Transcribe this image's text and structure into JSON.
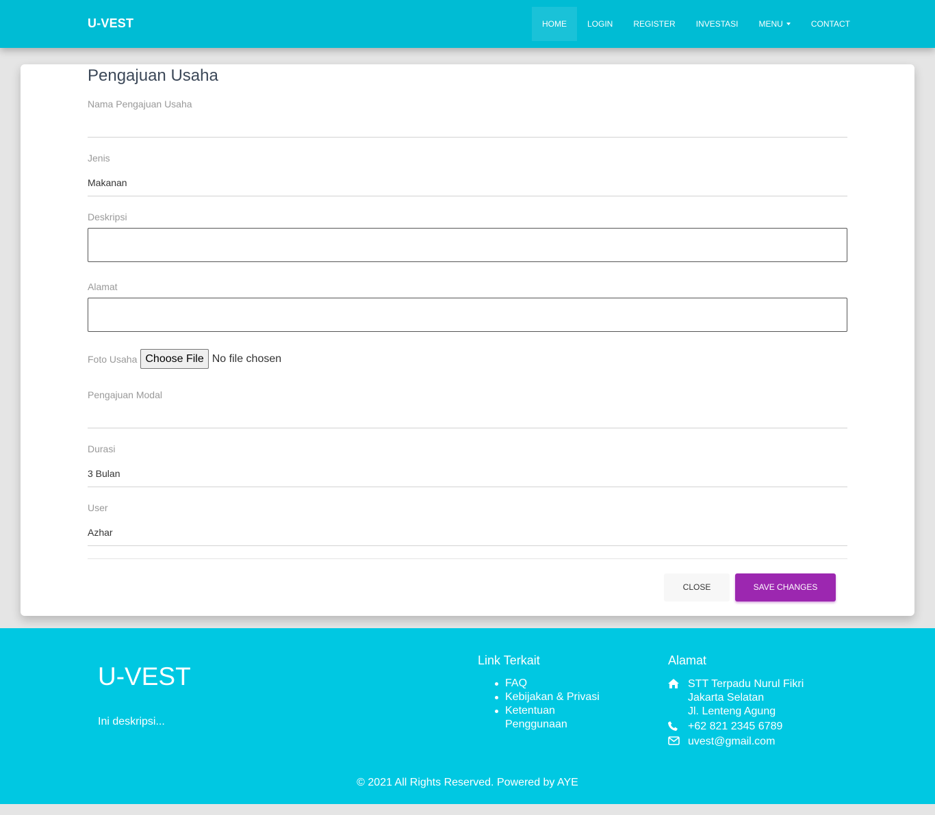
{
  "navbar": {
    "brand": "U-VEST",
    "items": [
      {
        "label": "Home"
      },
      {
        "label": "Login"
      },
      {
        "label": "Register"
      },
      {
        "label": "Investasi"
      },
      {
        "label": "Menu"
      },
      {
        "label": "Contact"
      }
    ]
  },
  "form": {
    "title": "Pengajuan Usaha",
    "nama_label": "Nama Pengajuan Usaha",
    "nama_value": "",
    "jenis_label": "Jenis",
    "jenis_value": "Makanan",
    "deskripsi_label": "Deskripsi",
    "alamat_label": "Alamat",
    "foto_label": "Foto Usaha",
    "foto_button": "Choose File",
    "foto_status": "No file chosen",
    "modal_label": "Pengajuan Modal",
    "modal_value": "",
    "durasi_label": "Durasi",
    "durasi_value": "3 Bulan",
    "user_label": "User",
    "user_value": "Azhar",
    "close_label": "Close",
    "save_label": "Save changes"
  },
  "footer": {
    "brand": "U-VEST",
    "description": "Ini deskripsi...",
    "links_title": "Link Terkait",
    "links": [
      "FAQ",
      "Kebijakan & Privasi",
      "Ketentuan",
      "Penggunaan"
    ],
    "address_title": "Alamat",
    "address_lines": [
      "STT Terpadu Nurul Fikri",
      "Jakarta Selatan",
      "Jl. Lenteng Agung"
    ],
    "phone": "+62 821 2345 6789",
    "email": "uvest@gmail.com",
    "copyright": "© 2021 All Rights Reserved. Powered by AYE"
  },
  "colors": {
    "navbar": "#00bcd4",
    "footer": "#00c8e2",
    "primary_button": "#9c27b0"
  },
  "icons": [
    "home-icon",
    "phone-icon",
    "envelope-icon",
    "caret-down-icon"
  ]
}
